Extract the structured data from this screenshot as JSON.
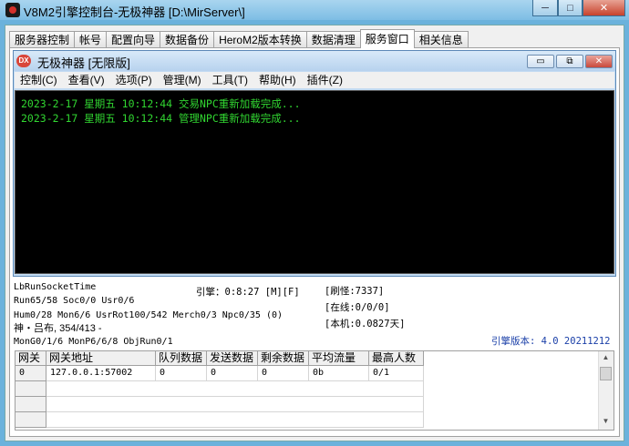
{
  "window": {
    "title": "V8M2引擎控制台-无极神器 [D:\\MirServer\\]",
    "minimize_glyph": "─",
    "maximize_glyph": "□",
    "close_glyph": "✕"
  },
  "tabs": [
    "服务器控制",
    "帐号",
    "配置向导",
    "数据备份",
    "HeroM2版本转换",
    "数据清理",
    "服务窗口",
    "相关信息"
  ],
  "active_tab": "服务窗口",
  "inner_window": {
    "icon_text": "DX",
    "title": "无极神器 [无限版]",
    "minimize_glyph": "▭",
    "restore_glyph": "⧉",
    "close_glyph": "✕"
  },
  "menus": [
    "控制(C)",
    "查看(V)",
    "选项(P)",
    "管理(M)",
    "工具(T)",
    "帮助(H)",
    "插件(Z)"
  ],
  "log_lines": [
    "2023-2-17 星期五 10:12:44 交易NPC重新加载完成...",
    "2023-2-17 星期五 10:12:44 管理NPC重新加载完成..."
  ],
  "status": {
    "run_socket": "LbRunSocketTime",
    "run_line": "Run65/58 Soc0/0 Usr0/6",
    "hum_line": "Hum0/28 Mon6/6 UsrRot100/542 Merch0/3 Npc0/35 (0)",
    "map_line": "神・吕布, 354/413 -",
    "mon_line": "MonG0/1/6 MonP6/6/8 ObjRun0/1",
    "engine": "引擎：0:8:27 [M][F]",
    "refresh": "[刷怪:7337]",
    "online": "[在线:0/0/0]",
    "local": "[本机:0.0827天]",
    "version": "引擎版本: 4.0 20211212"
  },
  "grid": {
    "headers": [
      "网关",
      "网关地址",
      "队列数据",
      "发送数据",
      "剩余数据",
      "平均流量",
      "最高人数"
    ],
    "rows": [
      [
        "0",
        "127.0.0.1:57002",
        "0",
        "0",
        "0",
        "0b",
        "0/1"
      ]
    ],
    "scroll_up": "▲",
    "scroll_down": "▼"
  },
  "colors": {
    "log_text": "#31d631",
    "console_bg": "#000000",
    "version_text": "#1a3fa8"
  }
}
